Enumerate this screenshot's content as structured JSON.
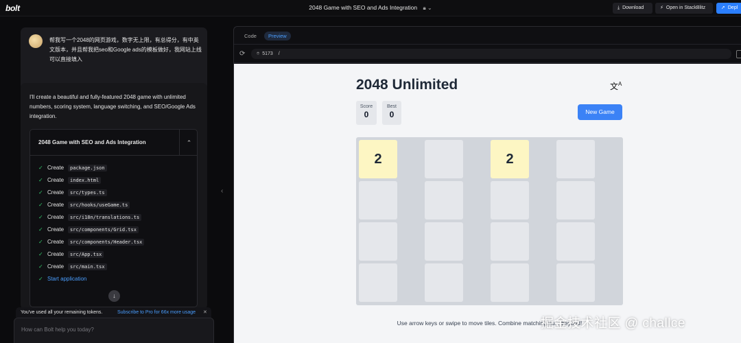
{
  "topbar": {
    "logo": "bolt",
    "project_title": "2048 Game with SEO and Ads Integration",
    "buttons": {
      "download": "Download",
      "stackblitz": "Open in StackBlitz",
      "deploy": "Depl"
    }
  },
  "chat": {
    "user_message": "帮我写一个2048的网页游戏，数字无上限，有总得分，有中英文版本，并且帮我把seo和Google ads的模板做好，我网站上线可以直接填入",
    "ai_message": "I'll create a beautiful and fully-featured 2048 game with unlimited numbers, scoring system, language switching, and SEO/Google Ads integration.",
    "artifact": {
      "title": "2048 Game with SEO and Ads Integration",
      "steps": [
        {
          "verb": "Create",
          "file": "package.json"
        },
        {
          "verb": "Create",
          "file": "index.html"
        },
        {
          "verb": "Create",
          "file": "src/types.ts"
        },
        {
          "verb": "Create",
          "file": "src/hooks/useGame.ts"
        },
        {
          "verb": "Create",
          "file": "src/i18n/translations.ts"
        },
        {
          "verb": "Create",
          "file": "src/components/Grid.tsx"
        },
        {
          "verb": "Create",
          "file": "src/components/Header.tsx"
        },
        {
          "verb": "Create",
          "file": "src/App.tsx"
        },
        {
          "verb": "Create",
          "file": "src/main.tsx"
        }
      ],
      "final_step": "Start application"
    },
    "token_notice": "You've used all your remaining tokens.",
    "token_subscribe": "Subscribe to Pro for 66x more usage",
    "prompt_placeholder": "How can Bolt help you today?"
  },
  "workbench": {
    "tabs": {
      "code": "Code",
      "preview": "Preview"
    },
    "url_port": "5173",
    "url_path": "/"
  },
  "game": {
    "title": "2048 Unlimited",
    "score_label": "Score",
    "score_value": "0",
    "best_label": "Best",
    "best_value": "0",
    "new_game_label": "New Game",
    "board": [
      [
        "2",
        "",
        "2",
        ""
      ],
      [
        "",
        "",
        "",
        ""
      ],
      [
        "",
        "",
        "",
        ""
      ],
      [
        "",
        "",
        "",
        ""
      ]
    ],
    "instructions": "Use arrow keys or swipe to move tiles. Combine matching nu... beyond!"
  },
  "watermark": "掘金技术社区 @ challce",
  "colors": {
    "accent": "#3b82f6",
    "tile_2": "#fdf6c3",
    "check": "#34c46a"
  }
}
